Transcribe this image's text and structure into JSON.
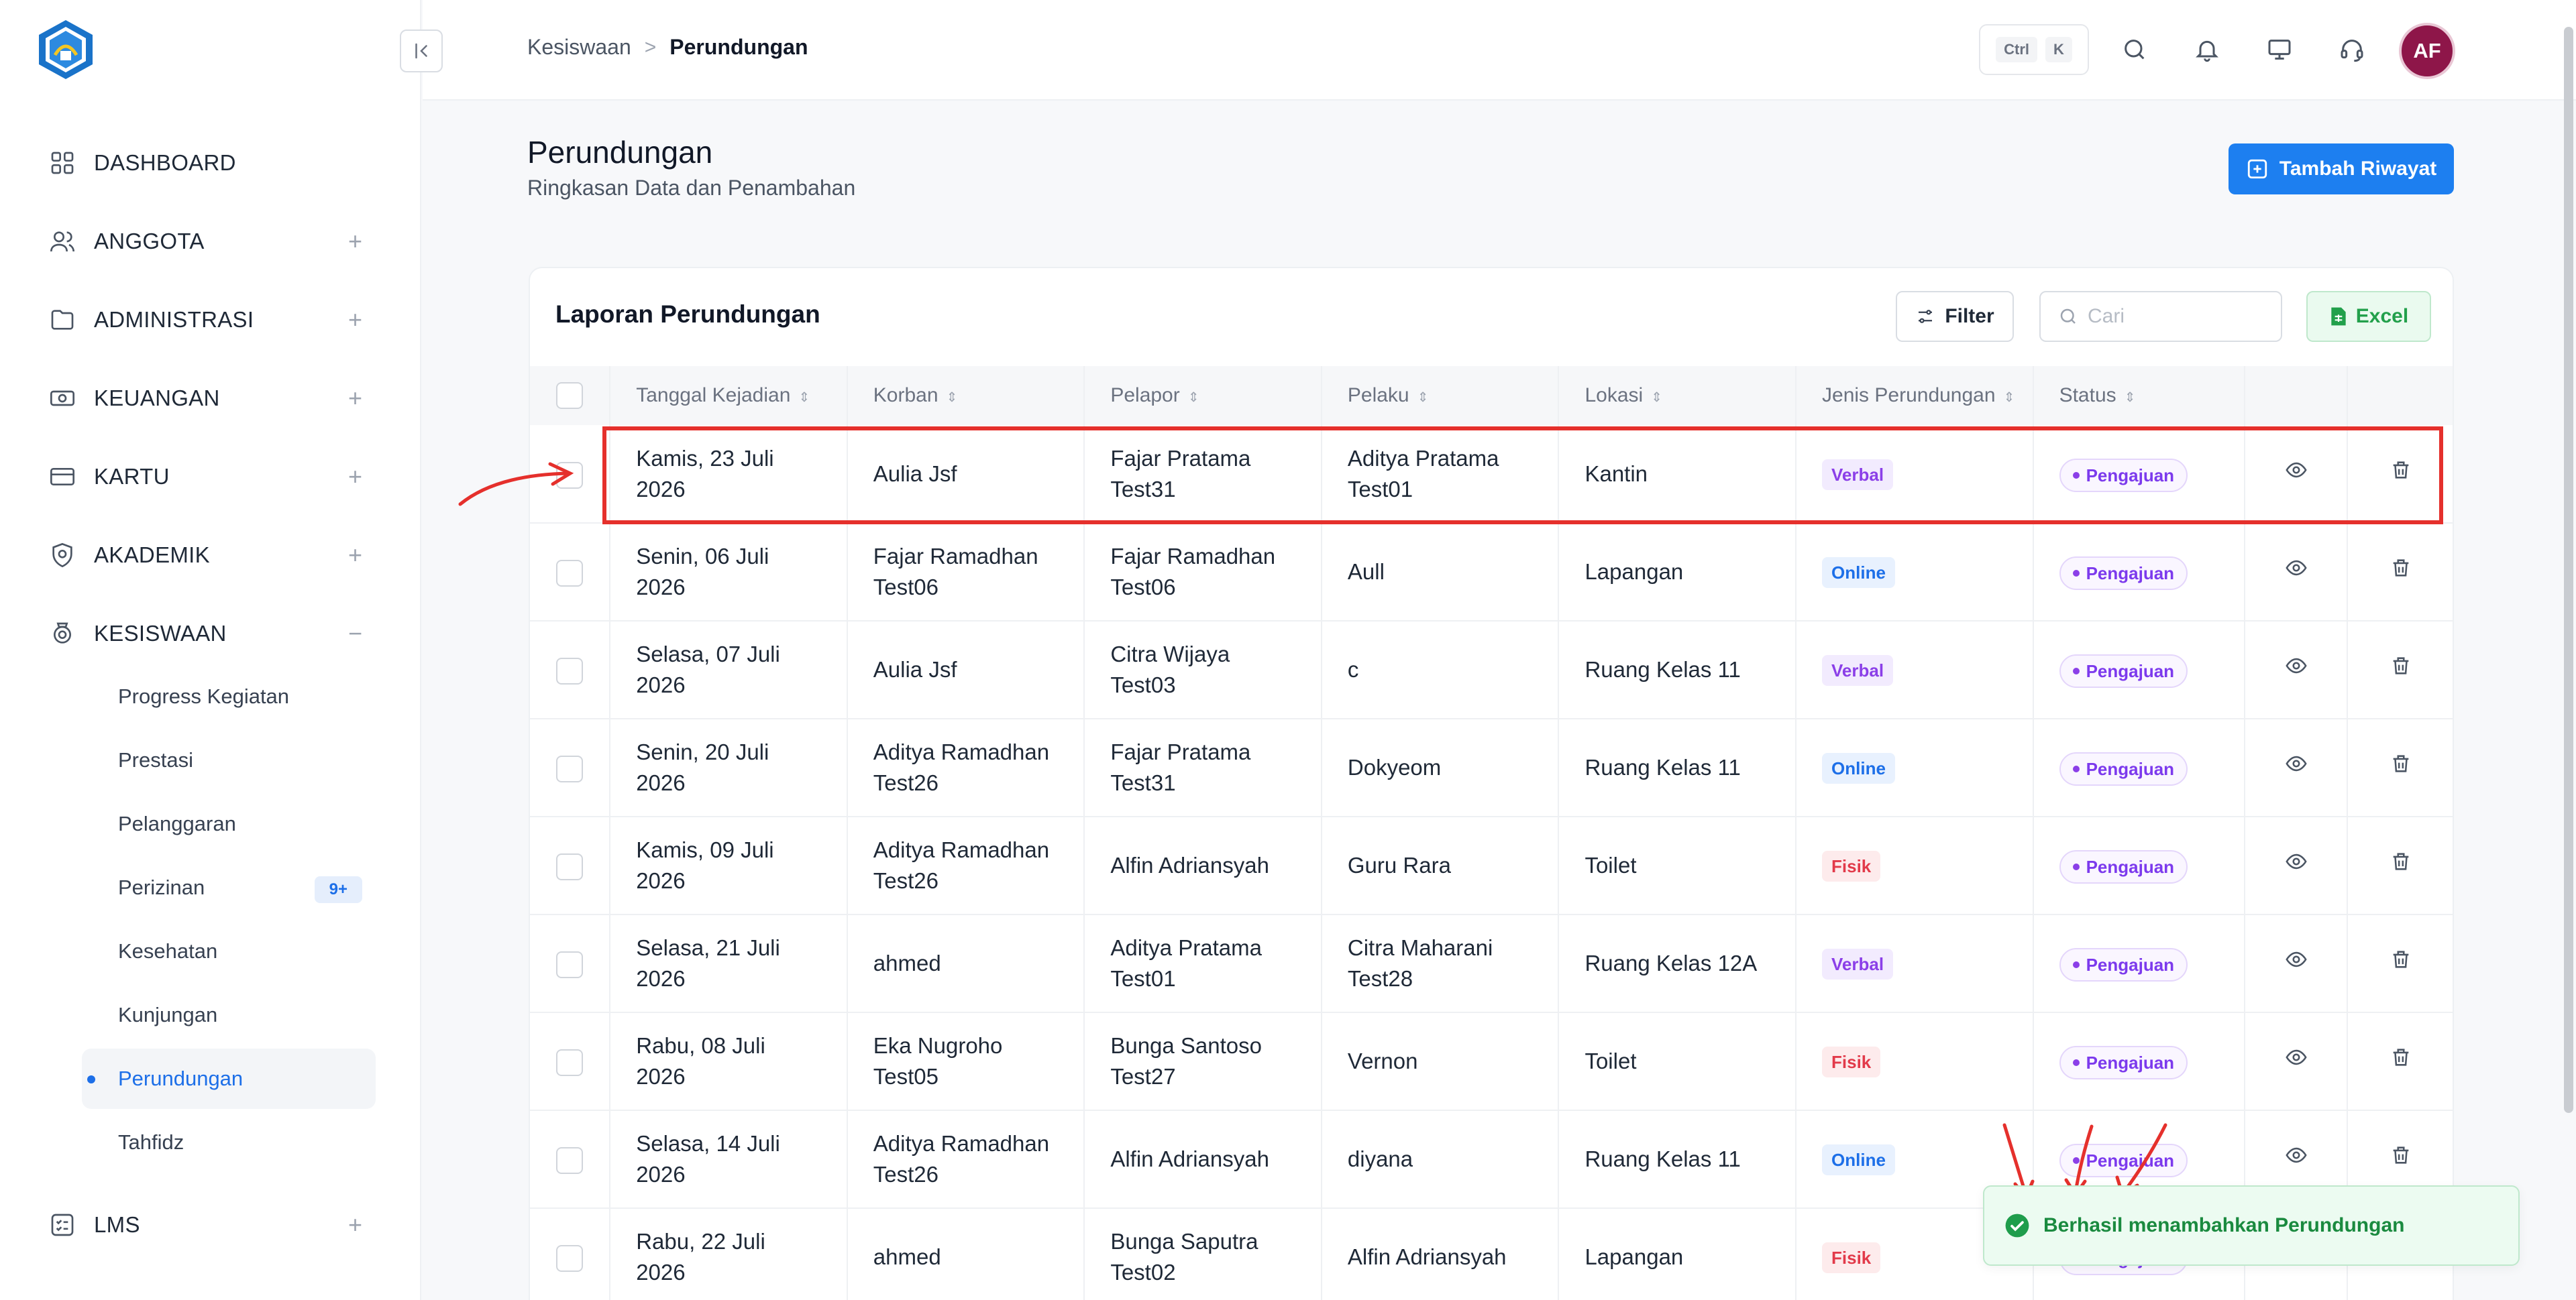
{
  "colors": {
    "primary": "#1d7ff0",
    "active_text": "#1d6fe8",
    "verbal": "#8b3fe8",
    "online": "#1d6fe8",
    "fisik": "#e23a4a",
    "success": "#1a8a3f",
    "annotation": "#e5302c"
  },
  "sidebar": {
    "items": [
      {
        "label": "DASHBOARD",
        "icon": "grid-icon",
        "toggle": ""
      },
      {
        "label": "ANGGOTA",
        "icon": "users-icon",
        "toggle": "+"
      },
      {
        "label": "ADMINISTRASI",
        "icon": "folder-icon",
        "toggle": "+"
      },
      {
        "label": "KEUANGAN",
        "icon": "money-icon",
        "toggle": "+"
      },
      {
        "label": "KARTU",
        "icon": "card-icon",
        "toggle": "+"
      },
      {
        "label": "AKADEMIK",
        "icon": "shield-icon",
        "toggle": "+"
      },
      {
        "label": "KESISWAAN",
        "icon": "student-icon",
        "toggle": "−"
      },
      {
        "label": "LMS",
        "icon": "checklist-icon",
        "toggle": "+"
      }
    ],
    "sub_items": [
      {
        "label": "Progress Kegiatan"
      },
      {
        "label": "Prestasi"
      },
      {
        "label": "Pelanggaran"
      },
      {
        "label": "Perizinan",
        "badge": "9+"
      },
      {
        "label": "Kesehatan"
      },
      {
        "label": "Kunjungan"
      },
      {
        "label": "Perundungan",
        "active": true
      },
      {
        "label": "Tahfidz"
      }
    ]
  },
  "topbar": {
    "breadcrumb": {
      "parent": "Kesiswaan",
      "separator": ">",
      "current": "Perundungan"
    },
    "shortcut": {
      "key1": "Ctrl",
      "key2": "K"
    },
    "avatar_initials": "AF"
  },
  "page": {
    "title": "Perundungan",
    "subtitle": "Ringkasan Data dan Penambahan",
    "add_button_label": "Tambah Riwayat"
  },
  "card": {
    "title": "Laporan Perundungan",
    "filter_label": "Filter",
    "search_placeholder": "Cari",
    "excel_label": "Excel"
  },
  "table": {
    "columns": [
      "Tanggal Kejadian",
      "Korban",
      "Pelapor",
      "Pelaku",
      "Lokasi",
      "Jenis Perundungan",
      "Status"
    ],
    "rows": [
      {
        "date_line1": "Kamis, 23 Juli",
        "date_line2": "2026",
        "korban_line1": "Aulia Jsf",
        "korban_line2": "",
        "pelapor_line1": "Fajar Pratama",
        "pelapor_line2": "Test31",
        "pelaku_line1": "Aditya Pratama",
        "pelaku_line2": "Test01",
        "lokasi": "Kantin",
        "jenis": "Verbal",
        "jenis_type": "verbal",
        "status": "Pengajuan"
      },
      {
        "date_line1": "Senin, 06 Juli",
        "date_line2": "2026",
        "korban_line1": "Fajar Ramadhan",
        "korban_line2": "Test06",
        "pelapor_line1": "Fajar Ramadhan",
        "pelapor_line2": "Test06",
        "pelaku_line1": "Aull",
        "pelaku_line2": "",
        "lokasi": "Lapangan",
        "jenis": "Online",
        "jenis_type": "online",
        "status": "Pengajuan"
      },
      {
        "date_line1": "Selasa, 07 Juli",
        "date_line2": "2026",
        "korban_line1": "Aulia Jsf",
        "korban_line2": "",
        "pelapor_line1": "Citra Wijaya",
        "pelapor_line2": "Test03",
        "pelaku_line1": "c",
        "pelaku_line2": "",
        "lokasi": "Ruang Kelas 11",
        "jenis": "Verbal",
        "jenis_type": "verbal",
        "status": "Pengajuan"
      },
      {
        "date_line1": "Senin, 20 Juli",
        "date_line2": "2026",
        "korban_line1": "Aditya Ramadhan",
        "korban_line2": "Test26",
        "pelapor_line1": "Fajar Pratama",
        "pelapor_line2": "Test31",
        "pelaku_line1": "Dokyeom",
        "pelaku_line2": "",
        "lokasi": "Ruang Kelas 11",
        "jenis": "Online",
        "jenis_type": "online",
        "status": "Pengajuan"
      },
      {
        "date_line1": "Kamis, 09 Juli",
        "date_line2": "2026",
        "korban_line1": "Aditya Ramadhan",
        "korban_line2": "Test26",
        "pelapor_line1": "Alfin Adriansyah",
        "pelapor_line2": "",
        "pelaku_line1": "Guru Rara",
        "pelaku_line2": "",
        "lokasi": "Toilet",
        "jenis": "Fisik",
        "jenis_type": "fisik",
        "status": "Pengajuan"
      },
      {
        "date_line1": "Selasa, 21 Juli",
        "date_line2": "2026",
        "korban_line1": "ahmed",
        "korban_line2": "",
        "pelapor_line1": "Aditya Pratama",
        "pelapor_line2": "Test01",
        "pelaku_line1": "Citra Maharani",
        "pelaku_line2": "Test28",
        "lokasi": "Ruang Kelas 12A",
        "jenis": "Verbal",
        "jenis_type": "verbal",
        "status": "Pengajuan"
      },
      {
        "date_line1": "Rabu, 08 Juli",
        "date_line2": "2026",
        "korban_line1": "Eka Nugroho",
        "korban_line2": "Test05",
        "pelapor_line1": "Bunga Santoso",
        "pelapor_line2": "Test27",
        "pelaku_line1": "Vernon",
        "pelaku_line2": "",
        "lokasi": "Toilet",
        "jenis": "Fisik",
        "jenis_type": "fisik",
        "status": "Pengajuan"
      },
      {
        "date_line1": "Selasa, 14 Juli",
        "date_line2": "2026",
        "korban_line1": "Aditya Ramadhan",
        "korban_line2": "Test26",
        "pelapor_line1": "Alfin Adriansyah",
        "pelapor_line2": "",
        "pelaku_line1": "diyana",
        "pelaku_line2": "",
        "lokasi": "Ruang Kelas 11",
        "jenis": "Online",
        "jenis_type": "online",
        "status": "Pengajuan"
      },
      {
        "date_line1": "Rabu, 22 Juli",
        "date_line2": "2026",
        "korban_line1": "ahmed",
        "korban_line2": "",
        "pelapor_line1": "Bunga Saputra",
        "pelapor_line2": "Test02",
        "pelaku_line1": "Alfin Adriansyah",
        "pelaku_line2": "",
        "lokasi": "Lapangan",
        "jenis": "Fisik",
        "jenis_type": "fisik",
        "status": "Pengajuan"
      }
    ]
  },
  "toast": {
    "message": "Berhasil menambahkan Perundungan",
    "icon": "check-circle-icon"
  }
}
